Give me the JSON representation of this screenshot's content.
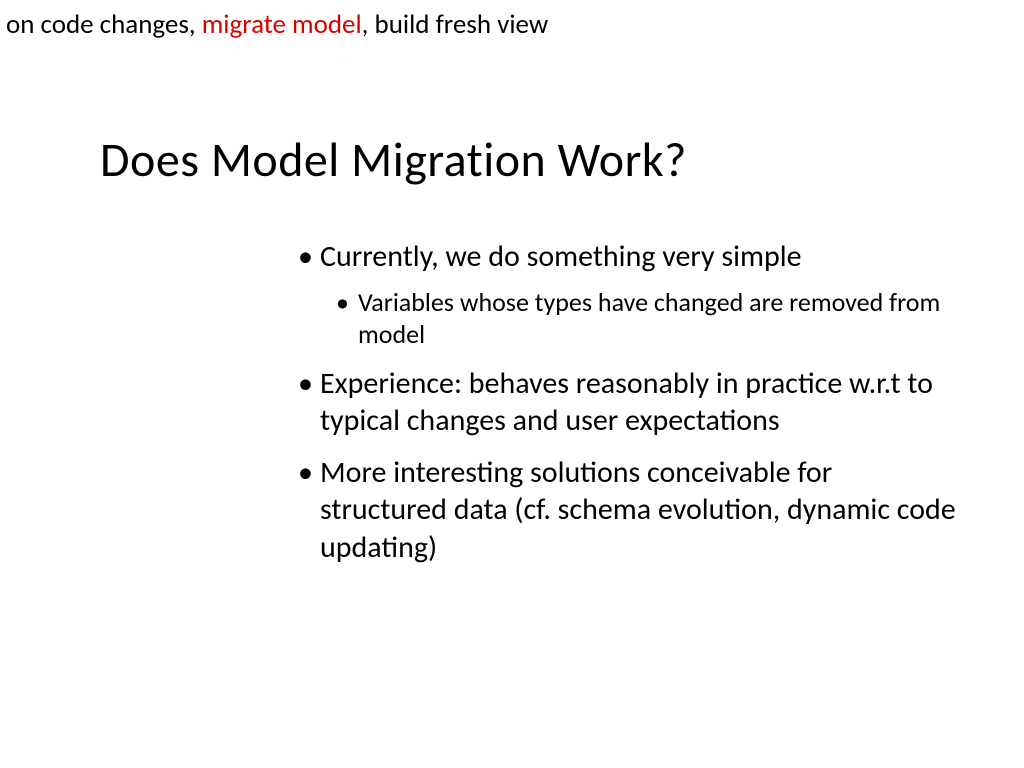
{
  "header": {
    "part1": "on code changes, ",
    "highlight": "migrate model",
    "part2": ", build fresh view"
  },
  "title": "Does Model Migration Work?",
  "bullets": {
    "b1": "Currently, we do something very simple",
    "b1_sub": "Variables whose types have changed are removed from model",
    "b2": "Experience: behaves reasonably in practice w.r.t to typical changes and user expectations",
    "b3": "More interesting solutions conceivable for structured data\n(cf. schema evolution, dynamic code updating)"
  }
}
